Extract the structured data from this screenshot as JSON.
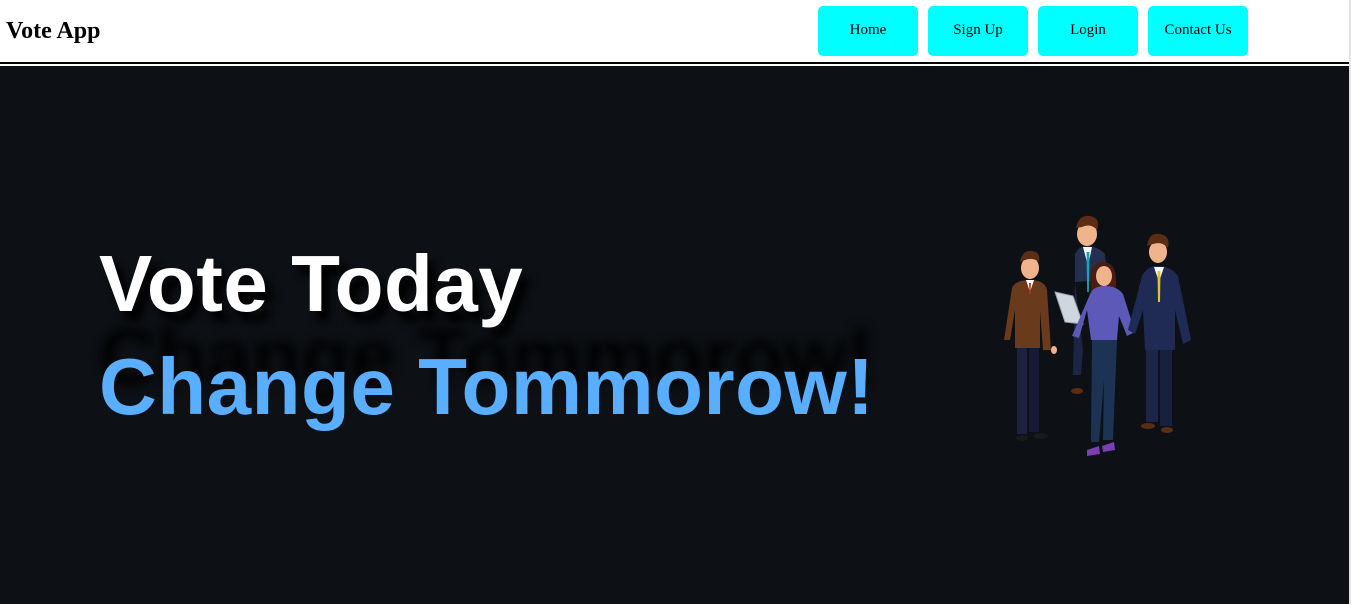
{
  "navbar": {
    "brand": "Vote App",
    "links": [
      {
        "label": "Home"
      },
      {
        "label": "Sign Up"
      },
      {
        "label": "Login"
      },
      {
        "label": "Contact Us"
      }
    ]
  },
  "hero": {
    "headline_line1": "Vote Today",
    "headline_line2": "Change Tommorow!",
    "illustration": "business-team-illustration"
  },
  "colors": {
    "nav_button": "#00ffff",
    "hero_background": "#0d1014",
    "headline_white": "#ffffff",
    "headline_blue": "#5aaeff"
  }
}
